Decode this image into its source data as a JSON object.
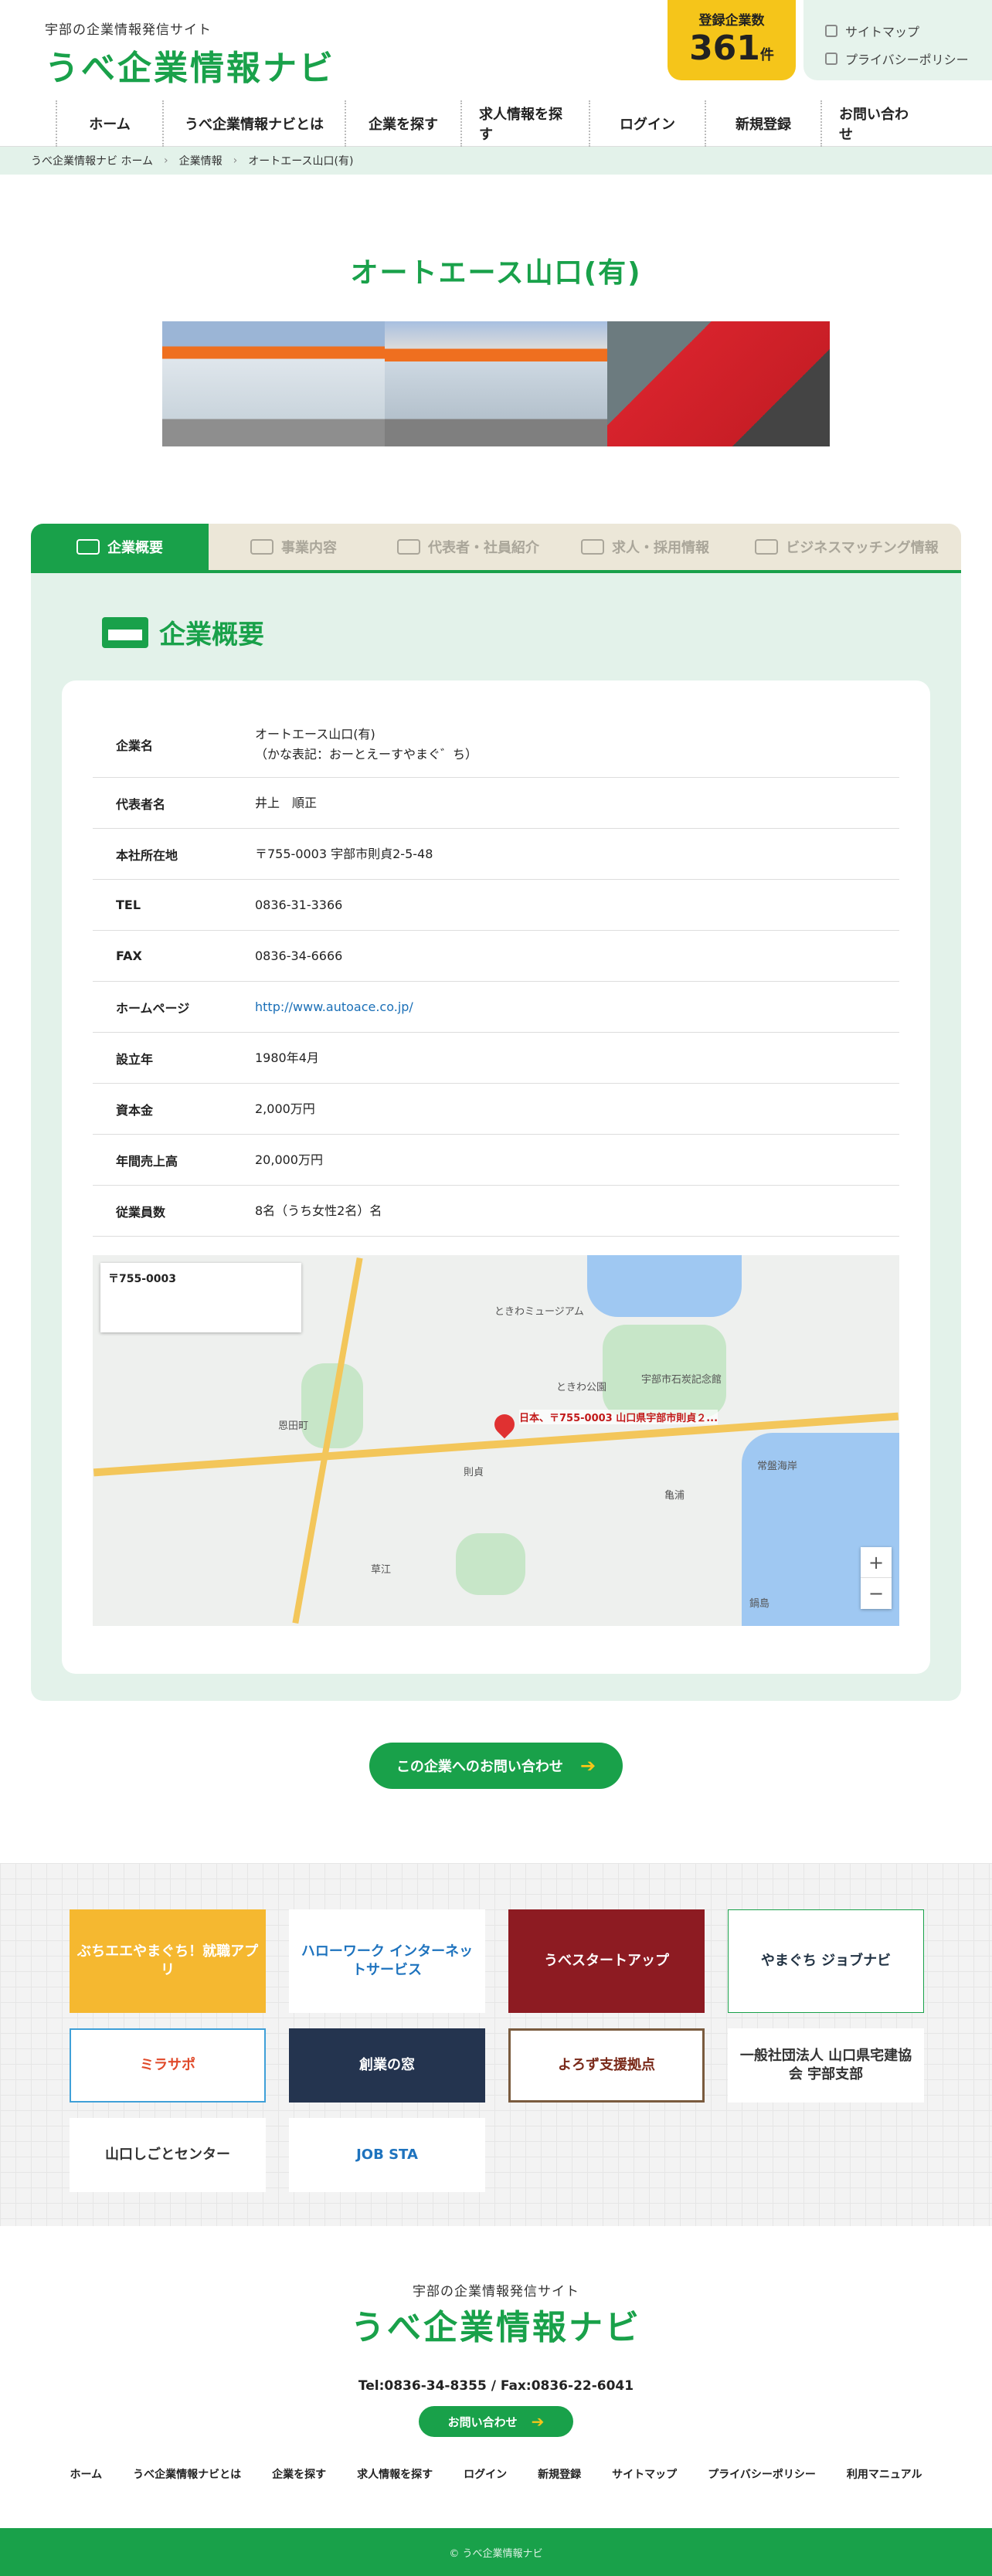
{
  "site": {
    "tagline": "宇部の企業情報発信サイト",
    "logo": "うべ企業情報ナビ",
    "count_label": "登録企業数",
    "count_value": "361",
    "count_unit": "件",
    "sitemap": "サイトマップ",
    "privacy": "プライバシーポリシー"
  },
  "nav": [
    "ホーム",
    "うべ企業情報ナビとは",
    "企業を探す",
    "求人情報を探す",
    "ログイン",
    "新規登録",
    "お問い合わせ"
  ],
  "breadcrumb": [
    "うべ企業情報ナビ ホーム",
    "企業情報",
    "オートエース山口(有)"
  ],
  "company": {
    "title": "オートエース山口(有)"
  },
  "tabs": [
    "企業概要",
    "事業内容",
    "代表者・社員紹介",
    "求人・採用情報",
    "ビジネスマッチング情報"
  ],
  "section_title": "企業概要",
  "info": [
    {
      "label": "企業名",
      "value": "オートエース山口(有)",
      "value2": "（かな表記：おーとえーすやまぐ゛ち）"
    },
    {
      "label": "代表者名",
      "value": "井上　順正"
    },
    {
      "label": "本社所在地",
      "value": "〒755-0003 宇部市則貞2-5-48"
    },
    {
      "label": "TEL",
      "value": "0836-31-3366"
    },
    {
      "label": "FAX",
      "value": "0836-34-6666"
    },
    {
      "label": "ホームページ",
      "value": "http://www.autoace.co.jp/"
    },
    {
      "label": "設立年",
      "value": "1980年4月"
    },
    {
      "label": "資本金",
      "value": "2,000万円"
    },
    {
      "label": "年間売上高",
      "value": "20,000万円"
    },
    {
      "label": "従業員数",
      "value": "8名（うち女性2名）名"
    }
  ],
  "map": {
    "info_title": "〒755-0003",
    "pin_label": "日本、〒755-0003 山口県宇部市則貞２...",
    "places": [
      "ときわミュージアム",
      "ときわ公園",
      "宇部市石炭記念館",
      "常盤海岸",
      "草江",
      "恩田町",
      "則貞",
      "亀浦",
      "鍋島"
    ],
    "zoom_in": "+",
    "zoom_out": "−"
  },
  "contact_button": "この企業へのお問い合わせ",
  "banners": [
    "ぶちエエやまぐち！就職アプリ",
    "ハローワーク インターネットサービス",
    "うべスタートアップ",
    "やまぐち ジョブナビ",
    "ミラサポ",
    "創業の窓",
    "よろず支援拠点",
    "一般社団法人 山口県宅建協会 宇部支部",
    "山口しごとセンター",
    "JOB STA"
  ],
  "footer": {
    "tagline": "宇部の企業情報発信サイト",
    "logo": "うべ企業情報ナビ",
    "tel": "Tel:0836-34-8355 / Fax:0836-22-6041",
    "contact": "お問い合わせ",
    "nav": [
      "ホーム",
      "うべ企業情報ナビとは",
      "企業を探す",
      "求人情報を探す",
      "ログイン",
      "新規登録",
      "サイトマップ",
      "プライバシーポリシー",
      "利用マニュアル"
    ],
    "copyright": "© うべ企業情報ナビ"
  },
  "colors": {
    "brand_green": "#19a14a",
    "accent_yellow": "#f5c51a",
    "panel_bg": "#e3f2ea"
  }
}
